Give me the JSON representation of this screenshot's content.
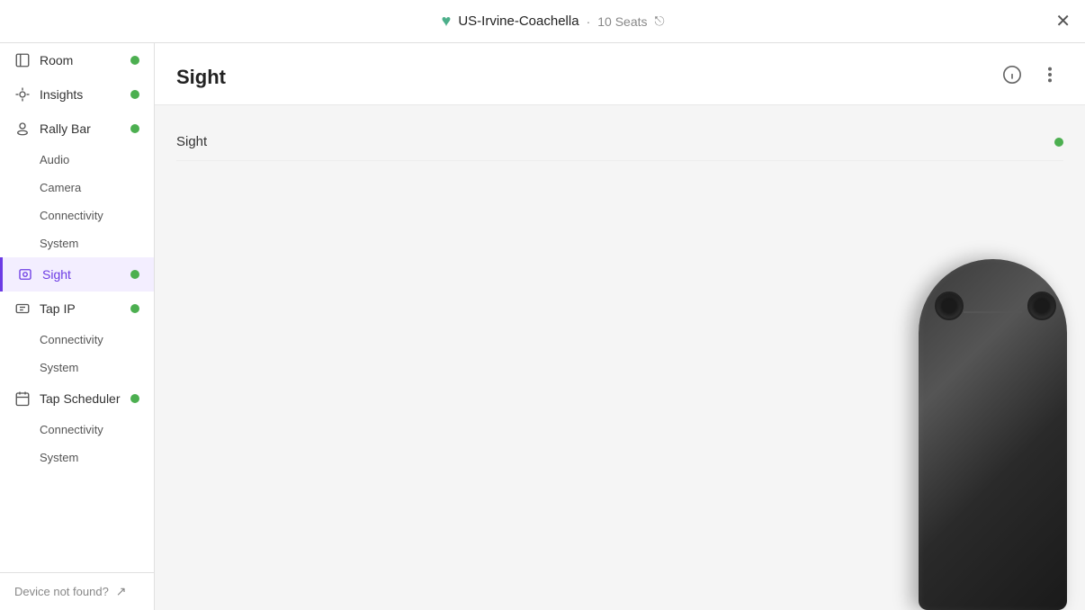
{
  "header": {
    "title": "US-Irvine-Coachella",
    "seats": "10 Seats",
    "close_label": "✕"
  },
  "sidebar": {
    "items": [
      {
        "id": "room",
        "label": "Room",
        "has_dot": true,
        "active": false,
        "is_sub": false
      },
      {
        "id": "insights",
        "label": "Insights",
        "has_dot": true,
        "active": false,
        "is_sub": false
      },
      {
        "id": "rally-bar",
        "label": "Rally Bar",
        "has_dot": true,
        "active": false,
        "is_sub": false
      },
      {
        "id": "audio",
        "label": "Audio",
        "has_dot": false,
        "active": false,
        "is_sub": true
      },
      {
        "id": "camera",
        "label": "Camera",
        "has_dot": false,
        "active": false,
        "is_sub": true
      },
      {
        "id": "connectivity-rb",
        "label": "Connectivity",
        "has_dot": false,
        "active": false,
        "is_sub": true
      },
      {
        "id": "system-rb",
        "label": "System",
        "has_dot": false,
        "active": false,
        "is_sub": true
      },
      {
        "id": "sight",
        "label": "Sight",
        "has_dot": true,
        "active": true,
        "is_sub": false
      },
      {
        "id": "tap-ip",
        "label": "Tap IP",
        "has_dot": true,
        "active": false,
        "is_sub": false
      },
      {
        "id": "connectivity-tip",
        "label": "Connectivity",
        "has_dot": false,
        "active": false,
        "is_sub": true
      },
      {
        "id": "system-tip",
        "label": "System",
        "has_dot": false,
        "active": false,
        "is_sub": true
      },
      {
        "id": "tap-scheduler",
        "label": "Tap Scheduler",
        "has_dot": true,
        "active": false,
        "is_sub": false
      },
      {
        "id": "connectivity-ts",
        "label": "Connectivity",
        "has_dot": false,
        "active": false,
        "is_sub": true
      },
      {
        "id": "system-ts",
        "label": "System",
        "has_dot": false,
        "active": false,
        "is_sub": true
      }
    ]
  },
  "main": {
    "title": "Sight",
    "device_row_label": "Sight",
    "device_status": "online"
  },
  "footer": {
    "not_found_label": "Device not found?",
    "link_icon": "↗"
  },
  "colors": {
    "green_dot": "#4caf50",
    "purple_active": "#6c3be4"
  }
}
